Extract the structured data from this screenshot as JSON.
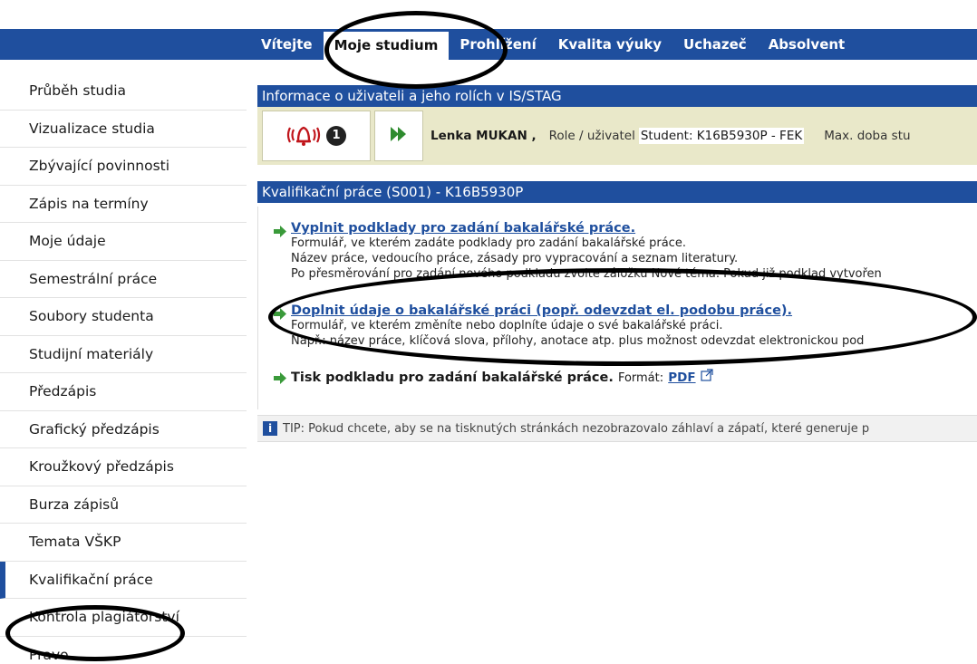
{
  "nav": {
    "tabs": [
      {
        "label": "Vítejte"
      },
      {
        "label": "Moje studium"
      },
      {
        "label": "Prohlížení"
      },
      {
        "label": "Kvalita výuky"
      },
      {
        "label": "Uchazeč"
      },
      {
        "label": "Absolvent"
      }
    ],
    "active_index": 1
  },
  "sidebar": {
    "items": [
      {
        "label": "Průběh studia"
      },
      {
        "label": "Vizualizace studia"
      },
      {
        "label": "Zbývající povinnosti"
      },
      {
        "label": "Zápis na termíny"
      },
      {
        "label": "Moje údaje"
      },
      {
        "label": "Semestrální práce"
      },
      {
        "label": "Soubory studenta"
      },
      {
        "label": "Studijní materiály"
      },
      {
        "label": "Předzápis"
      },
      {
        "label": "Grafický předzápis"
      },
      {
        "label": "Kroužkový předzápis"
      },
      {
        "label": "Burza zápisů"
      },
      {
        "label": "Temata VŠKP"
      },
      {
        "label": "Kvalifikační práce"
      },
      {
        "label": "Kontrola plagiátorství"
      },
      {
        "label": "Pravo"
      }
    ],
    "active_index": 13
  },
  "user_info": {
    "title": "Informace o uživateli a jeho rolích v IS/STAG",
    "notification_count": "1",
    "user_name": "Lenka MUKAN ,",
    "role_label": "Role / uživatel",
    "role_value": "Student: K16B5930P - FEK",
    "max_doba": "Max. doba stu"
  },
  "qualification": {
    "title": "Kvalifikační práce (S001) - K16B5930P",
    "entries": [
      {
        "link": "Vyplnit podklady pro zadání bakalářské práce.",
        "lines": [
          "Formulář, ve kterém zadáte podklady pro zadání bakalářské práce.",
          "Název práce, vedoucího práce, zásady pro vypracování a seznam literatury.",
          "Po přesměrování pro zadání nového podkladu zvolte záložku Nové téma. Pokud již podklad vytvořen"
        ]
      },
      {
        "link": "Doplnit údaje o bakalářské práci (popř. odevzdat el. podobu práce).",
        "lines": [
          "Formulář, ve kterém změníte nebo doplníte údaje o své bakalářské práci.",
          "Např.: název práce, klíčová slova, přílohy, anotace atp. plus možnost odevzdat elektronickou pod"
        ]
      }
    ],
    "print_label": "Tisk podkladu pro zadání bakalářské práce.",
    "format_label": "Formát:",
    "pdf_label": "PDF"
  },
  "tip": {
    "text": "TIP: Pokud chcete, aby se na tisknutých stránkách nezobrazovalo záhlaví a zápatí, které generuje p"
  },
  "colors": {
    "brand_blue": "#1f4f9e",
    "info_bg": "#e9e8c9",
    "link": "#1f4f9e",
    "arrow_green": "#3a9a3a",
    "bell_red": "#c0151b"
  }
}
